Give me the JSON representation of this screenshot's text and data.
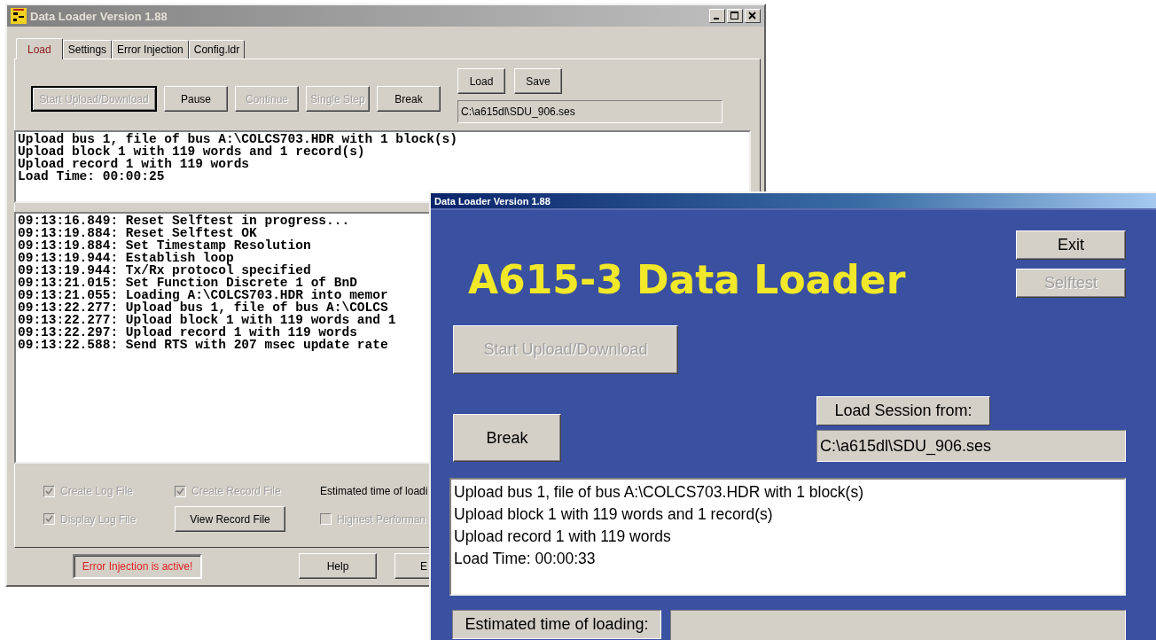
{
  "main_window": {
    "title": "Data Loader Version 1.88",
    "active": false,
    "tabs": [
      {
        "label": "Load",
        "selected": true
      },
      {
        "label": "Settings",
        "selected": false
      },
      {
        "label": "Error Injection",
        "selected": false
      },
      {
        "label": "Config.ldr",
        "selected": false
      }
    ],
    "toolbar_buttons": [
      {
        "label": "Start Upload/Download",
        "disabled": true,
        "focused": true
      },
      {
        "label": "Pause",
        "disabled": false,
        "focused": false
      },
      {
        "label": "Continue",
        "disabled": true,
        "focused": false
      },
      {
        "label": "Single Step",
        "disabled": true,
        "focused": false
      },
      {
        "label": "Break",
        "disabled": false,
        "focused": false
      }
    ],
    "session_buttons": [
      {
        "label": "Load",
        "disabled": false
      },
      {
        "label": "Save",
        "disabled": false
      }
    ],
    "session_path": "C:\\a615dl\\SDU_906.ses",
    "summary_lines": [
      "Upload bus 1, file of bus A:\\COLCS703.HDR with 1 block(s)",
      "Upload block 1 with 119 words and 1 record(s)",
      "Upload record 1 with 119 words",
      "Load Time: 00:00:25"
    ],
    "log_lines": [
      "09:13:16.849: Reset Selftest in progress...",
      "09:13:19.884: Reset Selftest OK",
      "09:13:19.884: Set Timestamp Resolution",
      "09:13:19.944: Establish loop",
      "09:13:19.944: Tx/Rx protocol specified",
      "09:13:21.015: Set Function Discrete 1 of BnD",
      "09:13:21.055: Loading A:\\COLCS703.HDR into memor",
      "09:13:22.277: Upload bus 1, file of bus A:\\COLCS",
      "09:13:22.277: Upload block 1 with 119 words and 1",
      "09:13:22.297: Upload record 1 with 119 words",
      "09:13:22.588: Send RTS with 207 msec update rate"
    ],
    "checkboxes": [
      {
        "label": "Create Log File",
        "checked": true,
        "disabled": true
      },
      {
        "label": "Display Log File",
        "checked": true,
        "disabled": true
      },
      {
        "label": "Create Record File",
        "checked": true,
        "disabled": true
      },
      {
        "label": "Highest Performan",
        "checked": false,
        "disabled": true
      }
    ],
    "view_record_button": "View Record File",
    "estimate_label": "Estimated time of loadi",
    "error_indicator": "Error Injection is active!",
    "footer_buttons": [
      {
        "label": "Help"
      },
      {
        "label": "E"
      }
    ]
  },
  "loader_window": {
    "title": "Data Loader Version 1.88",
    "active": true,
    "heading": "A615-3 Data Loader",
    "side_buttons": [
      {
        "label": "Exit",
        "disabled": false
      },
      {
        "label": "Selftest",
        "disabled": true
      }
    ],
    "start_button": {
      "label": "Start Upload/Download",
      "disabled": true
    },
    "break_button": {
      "label": "Break",
      "disabled": false
    },
    "session_label": "Load Session from:",
    "session_path": "C:\\a615dl\\SDU_906.ses",
    "summary_lines": [
      "Upload bus 1, file of bus A:\\COLCS703.HDR with 1 block(s)",
      "Upload block 1 with 119 words and 1 record(s)",
      "Upload record 1 with 119 words",
      "Load Time: 00:00:33"
    ],
    "estimate_label": "Estimated time of loading:"
  }
}
